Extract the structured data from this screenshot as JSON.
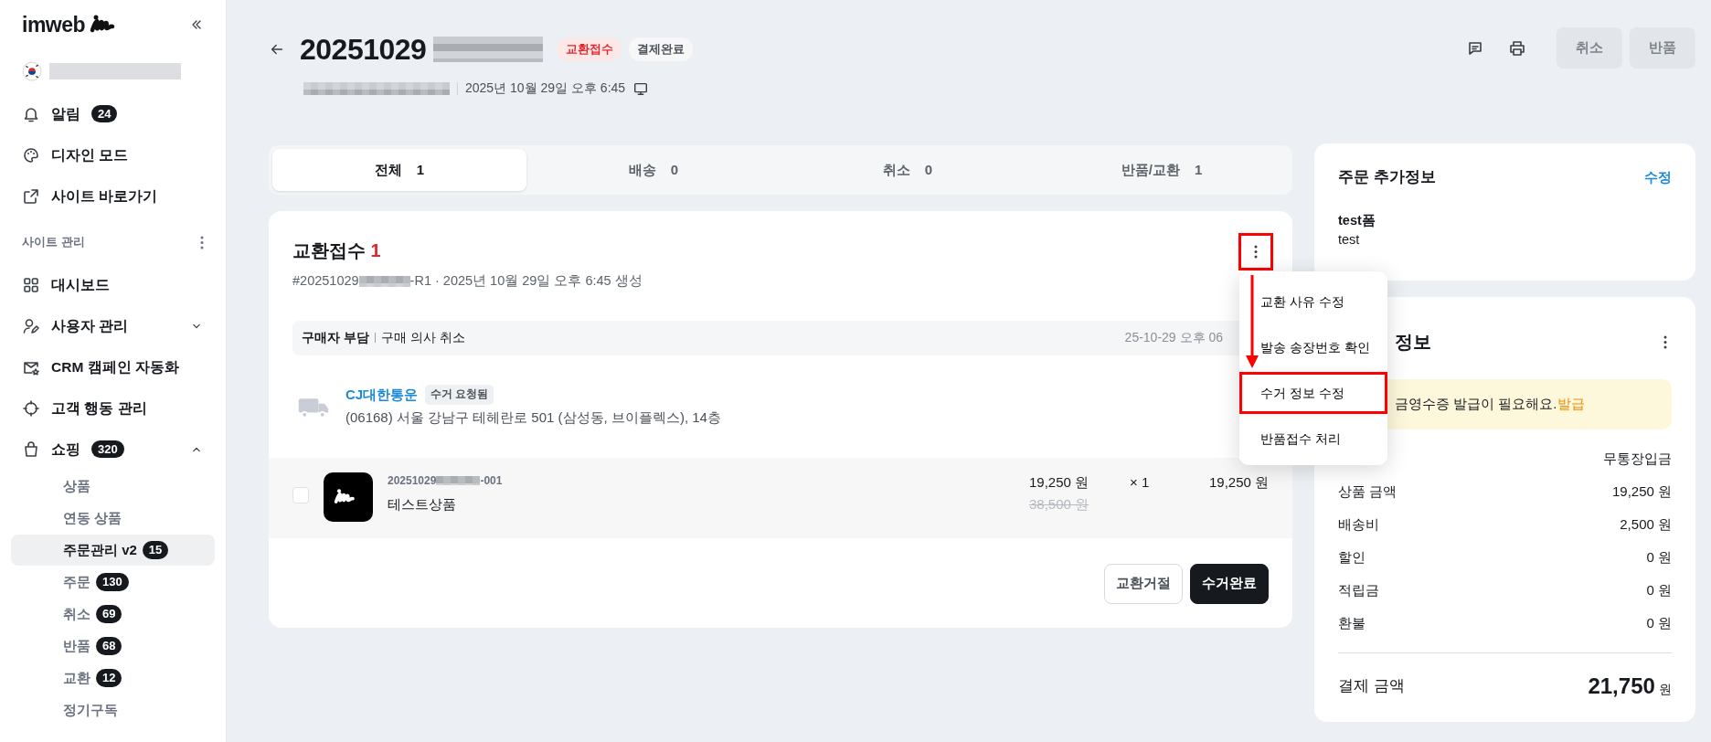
{
  "sidebar": {
    "logo": "imweb",
    "nav": [
      {
        "label": "알림",
        "badge": "24"
      },
      {
        "label": "디자인 모드"
      },
      {
        "label": "사이트 바로가기"
      }
    ],
    "section": {
      "label": "사이트 관리"
    },
    "items": [
      {
        "label": "대시보드"
      },
      {
        "label": "사용자 관리",
        "expanded": false
      },
      {
        "label": "CRM 캠페인 자동화"
      },
      {
        "label": "고객 행동 관리"
      },
      {
        "label": "쇼핑",
        "badge": "320",
        "expanded": true,
        "children": [
          {
            "label": "상품",
            "selected": false
          },
          {
            "label": "연동 상품",
            "selected": false
          },
          {
            "label": "주문관리 v2",
            "badge": "15",
            "selected": true
          },
          {
            "label": "주문",
            "badge": "130",
            "selected": false
          },
          {
            "label": "취소",
            "badge": "69",
            "selected": false
          },
          {
            "label": "반품",
            "badge": "68",
            "selected": false
          },
          {
            "label": "교환",
            "badge": "12",
            "selected": false
          },
          {
            "label": "정기구독",
            "selected": false
          }
        ]
      }
    ]
  },
  "header": {
    "order_number": "20251029",
    "tags": [
      {
        "label": "교환접수",
        "kind": "alert"
      },
      {
        "label": "결제완료",
        "kind": "neutral"
      }
    ],
    "date": "2025년 10월 29일 오후 6:45",
    "buttons": [
      {
        "label": "취소",
        "disabled": true
      },
      {
        "label": "반품",
        "disabled": true
      }
    ]
  },
  "tabs": [
    {
      "label": "전체",
      "count": "1",
      "selected": true
    },
    {
      "label": "배송",
      "count": "0",
      "selected": false
    },
    {
      "label": "취소",
      "count": "0",
      "selected": false
    },
    {
      "label": "반품/교환",
      "count": "1",
      "selected": false
    }
  ],
  "claim": {
    "title": "교환접수",
    "count": "1",
    "number_prefix": "#20251029",
    "number_suffix": "-R1 · 2025년 10월 29일 오후 6:45 생성",
    "more_highlighted": true,
    "info": {
      "payer": "구매자 부담",
      "reason": "구매 의사 취소",
      "date": "25-10-29 오후 06"
    },
    "carrier": {
      "name": "CJ대한통운",
      "status": "수거 요청됨",
      "address": "(06168) 서울 강남구 테헤란로 501 (삼성동, 브이플렉스), 14층"
    },
    "product": {
      "checked": false,
      "code_prefix": "20251029",
      "code_suffix": "-001",
      "name": "테스트상품",
      "price": "19,250 원",
      "quantity": "× 1",
      "original_price": "38,500 원",
      "total": "19,250 원"
    },
    "buttons": [
      {
        "label": "교환거절",
        "kind": "outline"
      },
      {
        "label": "수거완료",
        "kind": "dark"
      }
    ],
    "menu": [
      {
        "label": "교환 사유 수정",
        "highlighted": false
      },
      {
        "label": "발송 송장번호 확인",
        "highlighted": false
      },
      {
        "label": "수거 정보 수정",
        "highlighted": true
      },
      {
        "label": "반품접수 처리",
        "highlighted": false
      }
    ]
  },
  "extra_info": {
    "title": "주문 추가정보",
    "edit": "수정",
    "field_label": "test폼",
    "field_value": "test"
  },
  "payment": {
    "title": "정보",
    "notice": "금영수증 발급이 필요해요.",
    "notice_link": "발급",
    "method": "무통장입금",
    "rows": [
      {
        "label": "상품 금액",
        "value": "19,250 원"
      },
      {
        "label": "배송비",
        "value": "2,500 원"
      },
      {
        "label": "할인",
        "value": "0 원"
      },
      {
        "label": "적립금",
        "value": "0 원"
      },
      {
        "label": "환불",
        "value": "0 원"
      }
    ],
    "total_label": "결제 금액",
    "total_value": "21,750",
    "total_unit": "원"
  }
}
